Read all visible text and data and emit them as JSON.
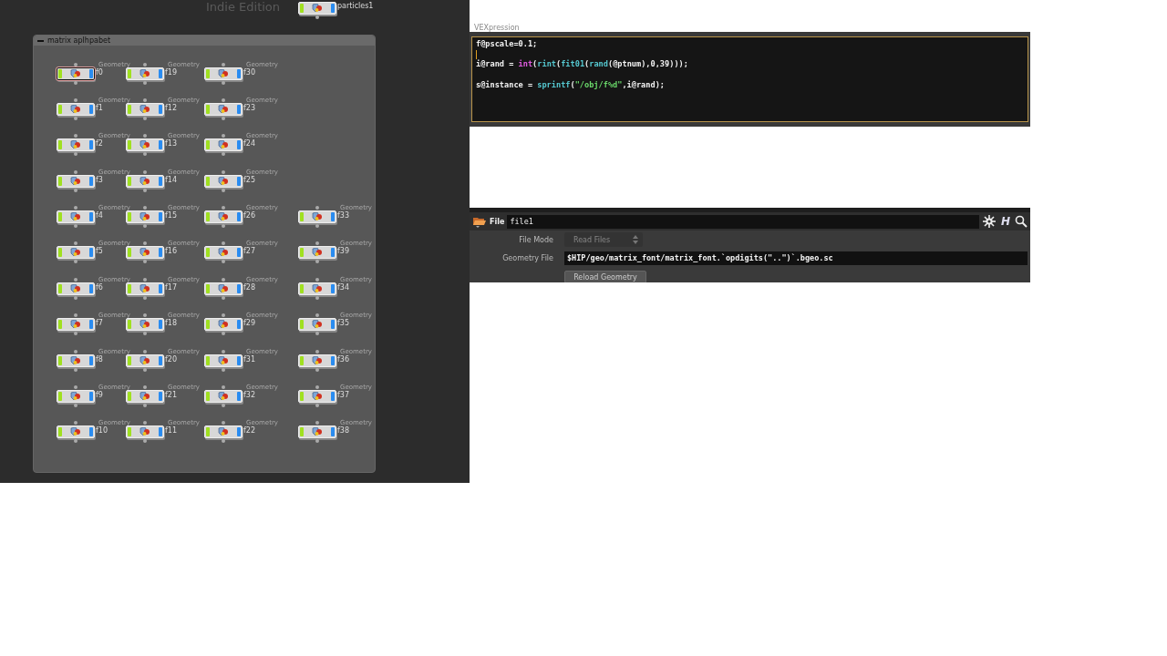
{
  "network": {
    "watermark": "Indie Edition",
    "top_node": {
      "name": "particles1",
      "selected": false
    },
    "box": {
      "title": "matrix aplhpabet",
      "columns": [
        {
          "nodes": [
            {
              "name": "f0",
              "type": "Geometry",
              "selected": true
            },
            {
              "name": "f1",
              "type": "Geometry",
              "selected": false
            },
            {
              "name": "f2",
              "type": "Geometry",
              "selected": false
            },
            {
              "name": "f3",
              "type": "Geometry",
              "selected": false
            },
            {
              "name": "f4",
              "type": "Geometry",
              "selected": false
            },
            {
              "name": "f5",
              "type": "Geometry",
              "selected": false
            },
            {
              "name": "f6",
              "type": "Geometry",
              "selected": false
            },
            {
              "name": "f7",
              "type": "Geometry",
              "selected": false
            },
            {
              "name": "f8",
              "type": "Geometry",
              "selected": false
            },
            {
              "name": "f9",
              "type": "Geometry",
              "selected": false
            },
            {
              "name": "f10",
              "type": "Geometry",
              "selected": false
            }
          ]
        },
        {
          "nodes": [
            {
              "name": "f19",
              "type": "Geometry",
              "selected": false
            },
            {
              "name": "f12",
              "type": "Geometry",
              "selected": false
            },
            {
              "name": "f13",
              "type": "Geometry",
              "selected": false
            },
            {
              "name": "f14",
              "type": "Geometry",
              "selected": false
            },
            {
              "name": "f15",
              "type": "Geometry",
              "selected": false
            },
            {
              "name": "f16",
              "type": "Geometry",
              "selected": false
            },
            {
              "name": "f17",
              "type": "Geometry",
              "selected": false
            },
            {
              "name": "f18",
              "type": "Geometry",
              "selected": false
            },
            {
              "name": "f20",
              "type": "Geometry",
              "selected": false
            },
            {
              "name": "f21",
              "type": "Geometry",
              "selected": false
            },
            {
              "name": "f11",
              "type": "Geometry",
              "selected": false
            }
          ]
        },
        {
          "nodes": [
            {
              "name": "f30",
              "type": "Geometry",
              "selected": false
            },
            {
              "name": "f23",
              "type": "Geometry",
              "selected": false
            },
            {
              "name": "f24",
              "type": "Geometry",
              "selected": false
            },
            {
              "name": "f25",
              "type": "Geometry",
              "selected": false
            },
            {
              "name": "f26",
              "type": "Geometry",
              "selected": false
            },
            {
              "name": "f27",
              "type": "Geometry",
              "selected": false
            },
            {
              "name": "f28",
              "type": "Geometry",
              "selected": false
            },
            {
              "name": "f29",
              "type": "Geometry",
              "selected": false
            },
            {
              "name": "f31",
              "type": "Geometry",
              "selected": false
            },
            {
              "name": "f32",
              "type": "Geometry",
              "selected": false
            },
            {
              "name": "f22",
              "type": "Geometry",
              "selected": false
            }
          ]
        },
        {
          "nodes": [
            {
              "name": "f33",
              "type": "Geometry",
              "selected": false
            },
            {
              "name": "f39",
              "type": "Geometry",
              "selected": false
            },
            {
              "name": "f34",
              "type": "Geometry",
              "selected": false
            },
            {
              "name": "f35",
              "type": "Geometry",
              "selected": false
            },
            {
              "name": "f36",
              "type": "Geometry",
              "selected": false
            },
            {
              "name": "f37",
              "type": "Geometry",
              "selected": false
            },
            {
              "name": "f38",
              "type": "Geometry",
              "selected": false
            }
          ]
        }
      ]
    }
  },
  "vex_panel": {
    "label": "VEXpression",
    "lines": [
      {
        "kind": "code",
        "tokens": [
          {
            "kind": "plain",
            "text": "f@pscale=0.1;"
          }
        ]
      },
      {
        "kind": "cursor"
      },
      {
        "kind": "code",
        "tokens": [
          {
            "kind": "plain",
            "text": "i@rand = "
          },
          {
            "kind": "keyword",
            "text": "int"
          },
          {
            "kind": "plain",
            "text": "("
          },
          {
            "kind": "func",
            "text": "rint"
          },
          {
            "kind": "plain",
            "text": "("
          },
          {
            "kind": "func",
            "text": "fit01"
          },
          {
            "kind": "plain",
            "text": "("
          },
          {
            "kind": "func",
            "text": "rand"
          },
          {
            "kind": "plain",
            "text": "(@ptnum),0,39)));"
          }
        ]
      },
      {
        "kind": "blank"
      },
      {
        "kind": "code",
        "tokens": [
          {
            "kind": "plain",
            "text": "s@instance = "
          },
          {
            "kind": "func",
            "text": "sprintf"
          },
          {
            "kind": "plain",
            "text": "("
          },
          {
            "kind": "string",
            "text": "\"/obj/f%d\""
          },
          {
            "kind": "plain",
            "text": ",i@rand);"
          }
        ]
      }
    ]
  },
  "parameters": {
    "node_type": "File",
    "node_name": "file1",
    "help_glyph": "H",
    "rows": [
      {
        "kind": "dropdown",
        "label": "File Mode",
        "value": "Read Files",
        "disabled": true
      },
      {
        "kind": "field",
        "label": "Geometry File",
        "value": "$HIP/geo/matrix_font/matrix_font.`opdigits(\"..\")`.bgeo.sc"
      },
      {
        "kind": "button",
        "text": "Reload Geometry"
      }
    ]
  }
}
